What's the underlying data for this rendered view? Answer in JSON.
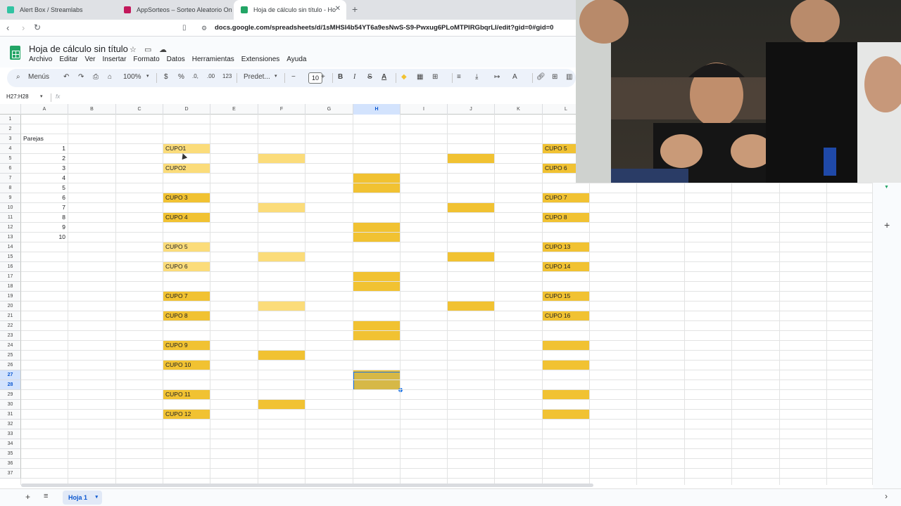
{
  "browser": {
    "tabs": [
      {
        "title": "Alert Box / Streamlabs",
        "color": "#31c3a2"
      },
      {
        "title": "AppSorteos – Sorteo Aleatorio On",
        "color": "#c2185b"
      },
      {
        "title": "Hoja de cálculo sin título - Ho",
        "color": "#23a566"
      }
    ],
    "url": "docs.google.com/spreadsheets/d/1sMHSI4b54YT6a9esNwS-S9-Pwxug6PLoMTPIRGbqrLI/edit?gid=0#gid=0"
  },
  "app": {
    "title": "Hoja de cálculo sin título",
    "menus": [
      "Archivo",
      "Editar",
      "Ver",
      "Insertar",
      "Formato",
      "Datos",
      "Herramientas",
      "Extensiones",
      "Ayuda"
    ]
  },
  "toolbar": {
    "search_label": "Menús",
    "zoom": "100%",
    "currency": "$",
    "percent": "%",
    "dec_decrease": ".0,",
    "dec_increase": ".00",
    "number_format": "123",
    "font": "Predet...",
    "font_size": "10"
  },
  "formula_bar": {
    "name_box": "H27:H28",
    "fx": "fx"
  },
  "columns": [
    "A",
    "B",
    "C",
    "D",
    "E",
    "F",
    "G",
    "H",
    "I",
    "J",
    "K",
    "L"
  ],
  "selected_column": "H",
  "selected_rows": [
    27,
    28
  ],
  "rows": 37,
  "cells": {
    "A3": "Parejas",
    "A4": "1",
    "A5": "2",
    "A6": "3",
    "A7": "4",
    "A8": "5",
    "A9": "6",
    "A10": "7",
    "A11": "8",
    "A12": "9",
    "A13": "10",
    "D4": "CUPO1",
    "D6": "CUPO2",
    "D9": "CUPO 3",
    "D11": "CUPO 4",
    "D14": "CUPO 5",
    "D16": "CUPO 6",
    "D19": "CUPO 7",
    "D21": "CUPO 8",
    "D24": "CUPO 9",
    "D26": "CUPO 10",
    "D29": "CUPO 11",
    "D31": "CUPO 12",
    "L4": "CUPO 5",
    "L6": "CUPO 6",
    "L9": "CUPO 7",
    "L11": "CUPO 8",
    "L14": "CUPO 13",
    "L16": "CUPO 14",
    "L19": "CUPO 15",
    "L21": "CUPO 16"
  },
  "fills": {
    "light": [
      "D4",
      "D6",
      "D14",
      "D16",
      "F5",
      "F10",
      "F15",
      "F20"
    ],
    "dark": [
      "D9",
      "D11",
      "D19",
      "D21",
      "D24",
      "D26",
      "D29",
      "D31",
      "F25",
      "F30",
      "H7",
      "H8",
      "H12",
      "H13",
      "H17",
      "H18",
      "H22",
      "H23",
      "H27",
      "H28",
      "J5",
      "J10",
      "J15",
      "J20",
      "L4",
      "L6",
      "L9",
      "L11",
      "L14",
      "L16",
      "L19",
      "L21",
      "L24",
      "L26",
      "L29",
      "L31"
    ]
  },
  "sheet": {
    "name": "Hoja 1"
  },
  "colors": {
    "dark_fill": "#f1c232",
    "light_fill": "#fbdc7a",
    "selection": "#1a73e8"
  }
}
